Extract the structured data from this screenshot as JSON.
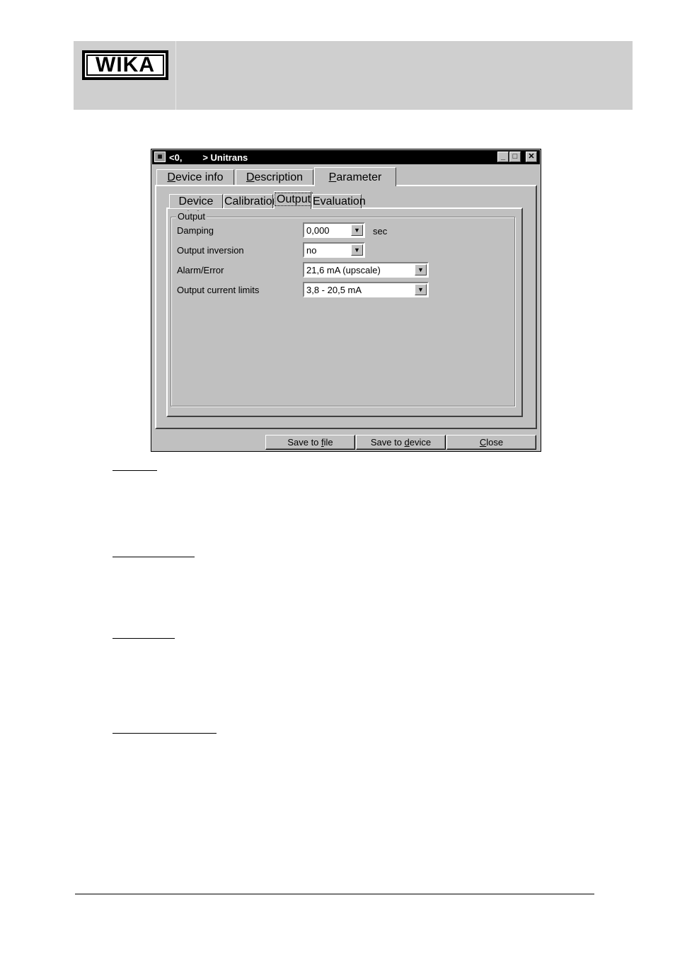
{
  "logo_text": "WIKA",
  "window": {
    "title": "<0,        > Unitrans"
  },
  "main_tabs": [
    {
      "pre": "",
      "key": "D",
      "post": "evice info"
    },
    {
      "pre": "",
      "key": "D",
      "post": "escription"
    },
    {
      "pre": "",
      "key": "P",
      "post": "arameter"
    }
  ],
  "sub_tabs": [
    "Device info",
    "Calibration",
    "Output",
    "Evaluation"
  ],
  "group_title": "Output",
  "fields": {
    "damping": {
      "label": "Damping",
      "value": "0,000",
      "unit": "sec"
    },
    "inversion": {
      "label": "Output inversion",
      "value": "no"
    },
    "alarm": {
      "label": "Alarm/Error",
      "value": "21,6 mA (upscale)"
    },
    "limits": {
      "label": "Output current limits",
      "value": "3,8 - 20,5 mA"
    }
  },
  "buttons": {
    "save_file": {
      "pre": "Save to ",
      "key": "f",
      "post": "ile"
    },
    "save_device": {
      "pre": "Save to ",
      "key": "d",
      "post": "evice"
    },
    "close": {
      "pre": "",
      "key": "C",
      "post": "lose"
    }
  }
}
